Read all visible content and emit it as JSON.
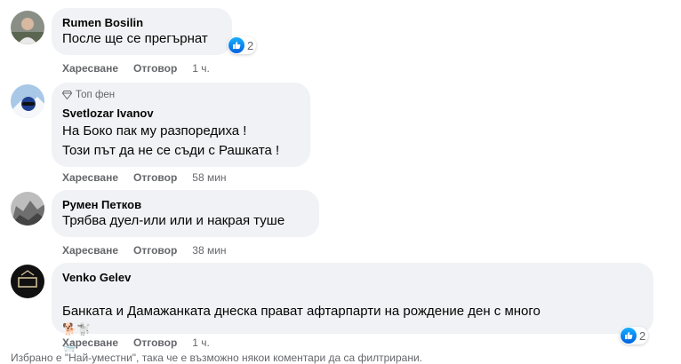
{
  "comments": [
    {
      "author": "Rumen Bosilin",
      "text": "После ще се прегърнат",
      "like": "Харесване",
      "reply": "Отговор",
      "time": "1 ч.",
      "reactions": "2"
    },
    {
      "badge": "Топ фен",
      "author": "Svetlozar Ivanov",
      "text": "На Боко пак му разпоредиха !\nТози път да не се съди с Рашката !",
      "like": "Харесване",
      "reply": "Отговор",
      "time": "58 мин"
    },
    {
      "author": "Румен Петков",
      "text": "Трябва дуел-или или и накрая туше",
      "like": "Харесване",
      "reply": "Отговор",
      "time": "38 мин"
    },
    {
      "author": "Venko Gelev",
      "text": "Банката и Дамажанката днеска прават афтарпарти на рождение ден с много",
      "emoji": "🐕🐩",
      "emoji2": "🛁",
      "like": "Харесване",
      "reply": "Отговор",
      "time": "1 ч.",
      "reactions": "2"
    }
  ],
  "footer_note": "Избрано е \"Най-уместни\", така че е възможно някои коментари да са филтрирани."
}
